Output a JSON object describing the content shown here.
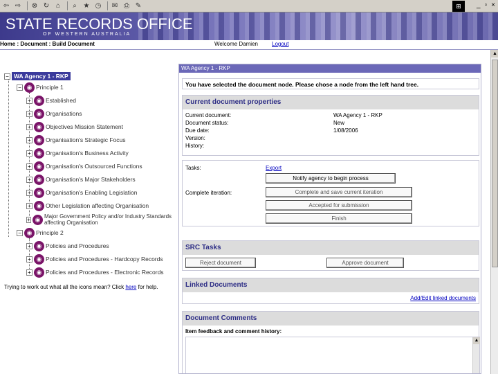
{
  "toolbar": {
    "icons": [
      "back-icon",
      "forward-icon",
      "stop-icon",
      "refresh-icon",
      "home-icon",
      "search-icon",
      "favorites-icon",
      "history-icon",
      "mail-icon",
      "print-icon",
      "edit-icon"
    ],
    "win_controls": [
      "_",
      "▫",
      "×"
    ]
  },
  "banner": {
    "title": "STATE RECORDS OFFICE",
    "subtitle": "OF WESTERN AUSTRALIA"
  },
  "nav": {
    "breadcrumb": "Home : Document : Build Document",
    "welcome": "Welcome Damien",
    "logout": "Logout"
  },
  "tree": {
    "root": "WA Agency 1 - RKP",
    "principle1": "Principle 1",
    "items": [
      "Established",
      "Organisations",
      "Objectives Mission Statement",
      "Organisation's Strategic Focus",
      "Organisation's Business Activity",
      "Organisation's Outsourced Functions",
      "Organisation's Major Stakeholders",
      "Organisation's Enabling Legislation",
      "Other Legislation affecting Organisation",
      "Major Government Policy and/or Industry Standards affecting Organisation"
    ],
    "principle2": "Principle 2",
    "principle2_items": [
      "Policies and Procedures",
      "Policies and Procedures - Hardcopy Records",
      "Policies and Procedures - Electronic Records"
    ],
    "help_text": "Trying to work out what all the icons mean? Click ",
    "help_link": "here",
    "help_after": " for help."
  },
  "panel": {
    "header": "WA Agency 1 - RKP",
    "notice": "You have selected the document node. Please chose a node from the left hand tree.",
    "props_title": "Current document properties",
    "props": [
      {
        "label": "Current document:",
        "value": "WA Agency 1 - RKP"
      },
      {
        "label": "Document status:",
        "value": "New"
      },
      {
        "label": "Due date:",
        "value": "1/08/2006"
      },
      {
        "label": "Version:",
        "value": ""
      },
      {
        "label": "History:",
        "value": ""
      }
    ],
    "tasks_label": "Tasks:",
    "export": "Export",
    "notify_btn": "Notify agency to begin process",
    "complete_iter_label": "Complete iteration:",
    "complete_btn": "Complete and save current iteration",
    "accepted_btn": "Accepted for submission",
    "finish_btn": "Finish",
    "src_title": "SRC Tasks",
    "reject_btn": "Reject document",
    "approve_btn": "Approve document",
    "linked_title": "Linked Documents",
    "linked_link": "Add/Edit linked documents",
    "comments_title": "Document Comments",
    "comments_sub": "Item feedback and comment history:"
  }
}
